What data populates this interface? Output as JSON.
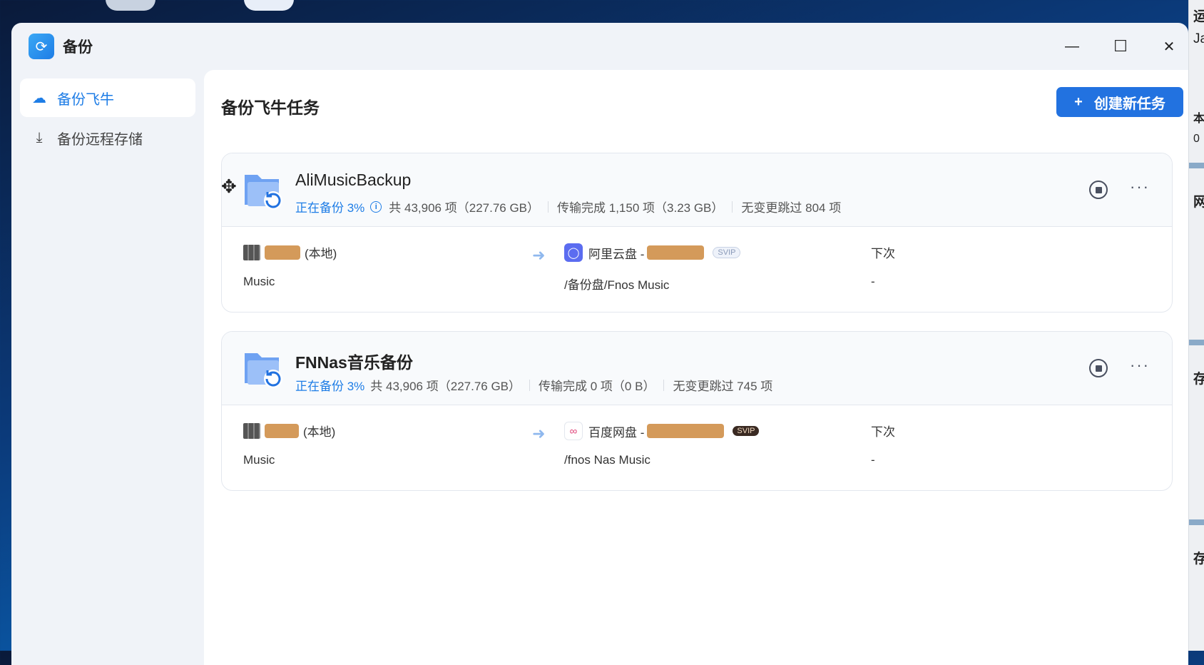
{
  "window": {
    "title": "备份",
    "minimize": "—",
    "maximize": "☐",
    "close": "✕"
  },
  "sidebar": {
    "items": [
      {
        "label": "备份飞牛",
        "icon": "cloud-upload-icon",
        "active": true
      },
      {
        "label": "备份远程存储",
        "icon": "download-icon",
        "active": false
      }
    ]
  },
  "main": {
    "heading": "备份飞牛任务",
    "create_button": "创建新任务",
    "create_icon": "+"
  },
  "tasks": [
    {
      "name": "AliMusicBackup",
      "status": "正在备份 3%",
      "total": "共 43,906 项（227.76 GB）",
      "transferred": "传输完成 1,150 项（3.23 GB）",
      "skipped": "无变更跳过 804 项",
      "source_suffix": "(本地)",
      "source_path": "Music",
      "dest_service": "阿里云盘 -",
      "dest_badge": "SVIP",
      "dest_path": "/备份盘/Fnos Music",
      "next_label": "下次",
      "next_value": "-"
    },
    {
      "name": "FNNas音乐备份",
      "status": "正在备份 3%",
      "total": "共 43,906 项（227.76 GB）",
      "transferred": "传输完成 0 项（0 B）",
      "skipped": "无变更跳过 745 项",
      "source_suffix": "(本地)",
      "source_path": "Music",
      "dest_service": "百度网盘 -",
      "dest_badge": "SVIP",
      "dest_path": "/fnos Nas Music",
      "next_label": "下次",
      "next_value": "-"
    }
  ],
  "side_widget": [
    "运",
    "Ja",
    "本",
    "0",
    "网",
    "存",
    "存"
  ],
  "colors": {
    "accent": "#2272e0",
    "redacted": "#d49a5a"
  }
}
